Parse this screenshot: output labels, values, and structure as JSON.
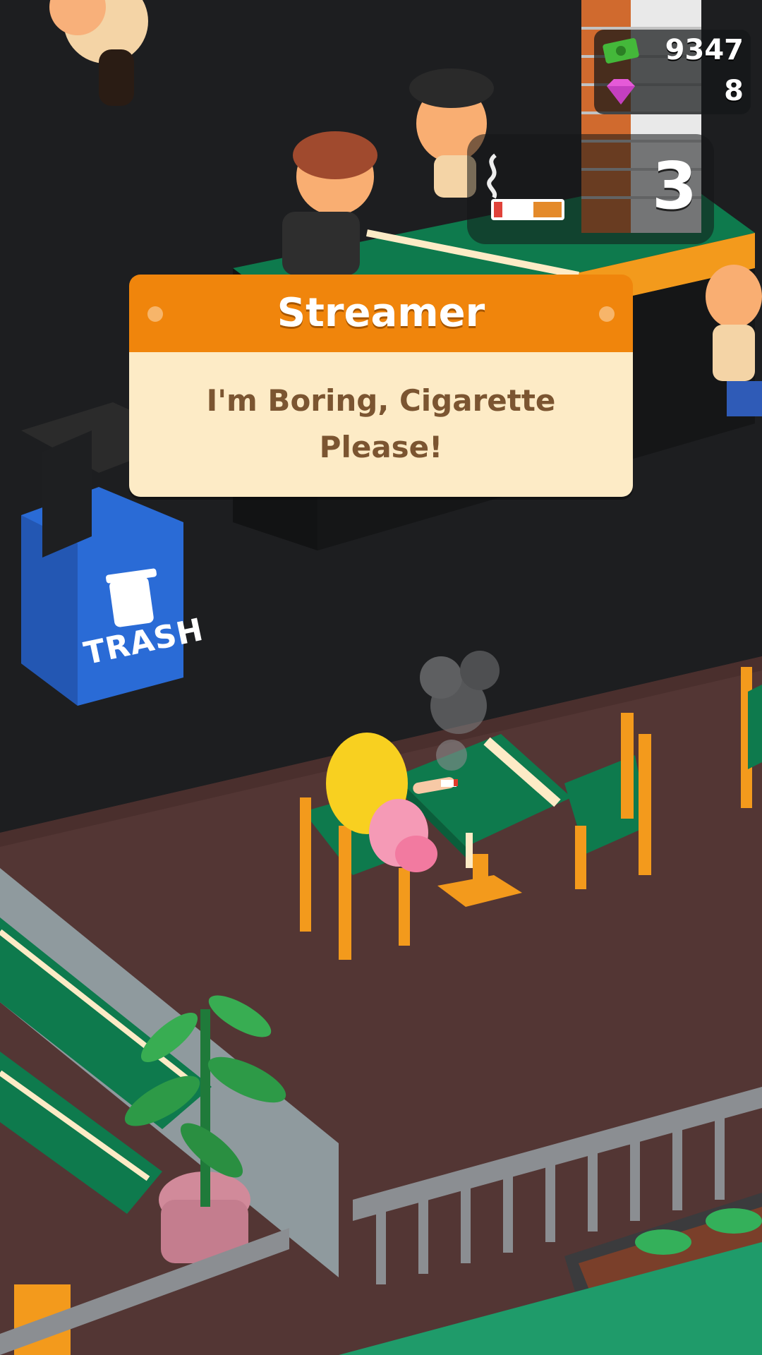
{
  "hud": {
    "cash": "9347",
    "gems": "8",
    "cash_icon": "cash-icon",
    "gem_icon": "gem-icon"
  },
  "cigarette_counter": {
    "value": "3",
    "icon": "cigarette-icon"
  },
  "popup": {
    "title": "Streamer",
    "message_line1": "I'm Boring, Cigarette",
    "message_line2": "Please!"
  },
  "trash_bin": {
    "label": "TRASH",
    "icon": "trash-icon"
  },
  "colors": {
    "popup_header": "#f0850c",
    "popup_body": "#fdebc6",
    "table_green": "#0e7a4d",
    "floor_brown": "#533634",
    "trash_blue": "#2a6bd6"
  }
}
